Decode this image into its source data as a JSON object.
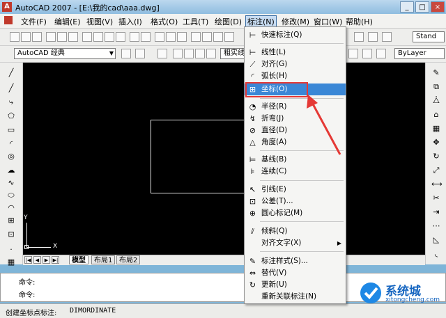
{
  "window": {
    "title": "AutoCAD 2007 - [E:\\我的cad\\aaa.dwg]",
    "min": "_",
    "max": "□",
    "close": "×"
  },
  "menubar": {
    "items": [
      "文件(F)",
      "编辑(E)",
      "视图(V)",
      "插入(I)",
      "格式(O)",
      "工具(T)",
      "绘图(D)",
      "标注(N)",
      "修改(M)",
      "窗口(W)",
      "帮助(H)"
    ]
  },
  "toolbar2": {
    "workspace": "AutoCAD 经典",
    "bylayer": "ByLayer",
    "linetype_label": "粗实线",
    "style": "Stand"
  },
  "dropdown": {
    "items": [
      {
        "icon": "quick-dim-icon",
        "glyph": "⊢",
        "label": "快速标注(Q)"
      },
      {
        "icon": "linear-icon",
        "glyph": "⊢",
        "label": "线性(L)"
      },
      {
        "icon": "aligned-icon",
        "glyph": "⟋",
        "label": "对齐(G)"
      },
      {
        "icon": "arc-length-icon",
        "glyph": "◜",
        "label": "弧长(H)"
      },
      {
        "icon": "ordinate-icon",
        "glyph": "⊞",
        "label": "坐标(O)"
      },
      {
        "icon": "radius-icon",
        "glyph": "◔",
        "label": "半径(R)"
      },
      {
        "icon": "jogged-icon",
        "glyph": "↯",
        "label": "折弯(J)"
      },
      {
        "icon": "diameter-icon",
        "glyph": "⊘",
        "label": "直径(D)"
      },
      {
        "icon": "angular-icon",
        "glyph": "△",
        "label": "角度(A)"
      },
      {
        "icon": "baseline-icon",
        "glyph": "⊨",
        "label": "基线(B)"
      },
      {
        "icon": "continue-icon",
        "glyph": "⊧",
        "label": "连续(C)"
      },
      {
        "icon": "leader-icon",
        "glyph": "↖",
        "label": "引线(E)"
      },
      {
        "icon": "tolerance-icon",
        "glyph": "⊡",
        "label": "公差(T)..."
      },
      {
        "icon": "center-mark-icon",
        "glyph": "⊕",
        "label": "圆心标记(M)"
      },
      {
        "icon": "oblique-icon",
        "glyph": "⫽",
        "label": "倾斜(Q)"
      },
      {
        "icon": "",
        "glyph": "",
        "label": "对齐文字(X)"
      },
      {
        "icon": "dim-style-icon",
        "glyph": "✎",
        "label": "标注样式(S)..."
      },
      {
        "icon": "override-icon",
        "glyph": "⇔",
        "label": "替代(V)"
      },
      {
        "icon": "update-icon",
        "glyph": "↻",
        "label": "更新(U)"
      },
      {
        "icon": "",
        "glyph": "",
        "label": "重新关联标注(N)"
      }
    ]
  },
  "layout_tabs": [
    "模型",
    "布局1",
    "布局2"
  ],
  "command": {
    "line1": "命令:",
    "line2": "命令:"
  },
  "status": {
    "text": "创建坐标点标注:",
    "cmd": "DIMORDINATE"
  },
  "ucs": {
    "x": "X",
    "y": "Y"
  },
  "watermark": {
    "brand": "系统城",
    "url": "xitongcheng.com"
  },
  "colors": {
    "highlight": "#3a87d6",
    "annotation": "#e53935",
    "canvas": "#000000"
  }
}
